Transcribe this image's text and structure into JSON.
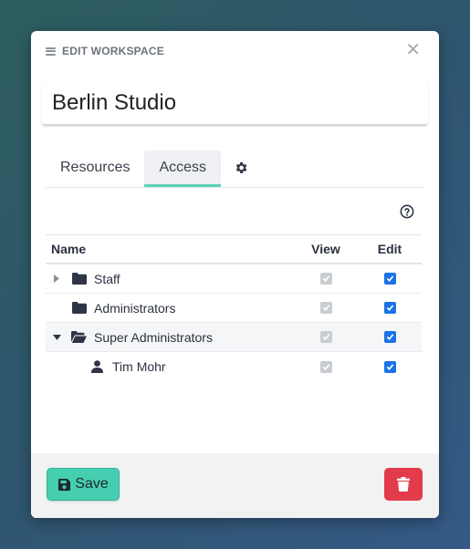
{
  "dialog": {
    "title": "EDIT WORKSPACE",
    "close_glyph": "✕"
  },
  "name_field": {
    "value": "Berlin Studio"
  },
  "tabs": [
    {
      "label": "Resources",
      "active": false
    },
    {
      "label": "Access",
      "active": true
    },
    {
      "label": "",
      "icon": "gear-icon",
      "active": false
    }
  ],
  "grid": {
    "headers": {
      "name": "Name",
      "view": "View",
      "edit": "Edit"
    },
    "rows": [
      {
        "label": "Staff",
        "icon": "folder-icon",
        "caret": "right",
        "view": true,
        "edit": true
      },
      {
        "label": "Administrators",
        "icon": "folder-icon",
        "caret": "none",
        "view": true,
        "edit": true
      },
      {
        "label": "Super Administrators",
        "icon": "folder-open-icon",
        "caret": "down",
        "view": true,
        "edit": true
      },
      {
        "label": "Tim Mohr",
        "icon": "user-icon",
        "caret": "none",
        "view": true,
        "edit": true
      }
    ]
  },
  "footer": {
    "save_label": "Save"
  },
  "colors": {
    "accent": "#45cfb0",
    "danger": "#e23b4c",
    "checkbox": "#1a73e8"
  }
}
